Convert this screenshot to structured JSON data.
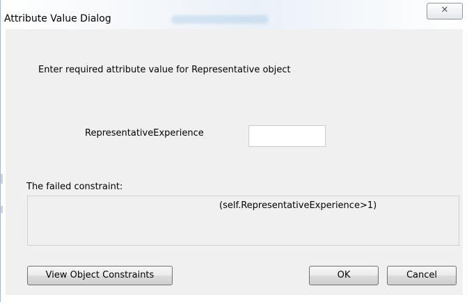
{
  "window": {
    "title": "Attribute Value Dialog",
    "close_glyph": "✕"
  },
  "dialog": {
    "prompt": "Enter required attribute value for Representative object",
    "field_label": "RepresentativeExperience",
    "field_value": "",
    "failed_label": "The failed constraint:",
    "constraint": "(self.RepresentativeExperience>1)"
  },
  "buttons": {
    "view_constraints": "View Object Constraints",
    "ok": "OK",
    "cancel": "Cancel"
  },
  "colors": {
    "client_bg": "#f0f0f0",
    "title_bg": "#ffffff",
    "button_border": "#707070"
  },
  "icons": {
    "close": "close-icon"
  }
}
